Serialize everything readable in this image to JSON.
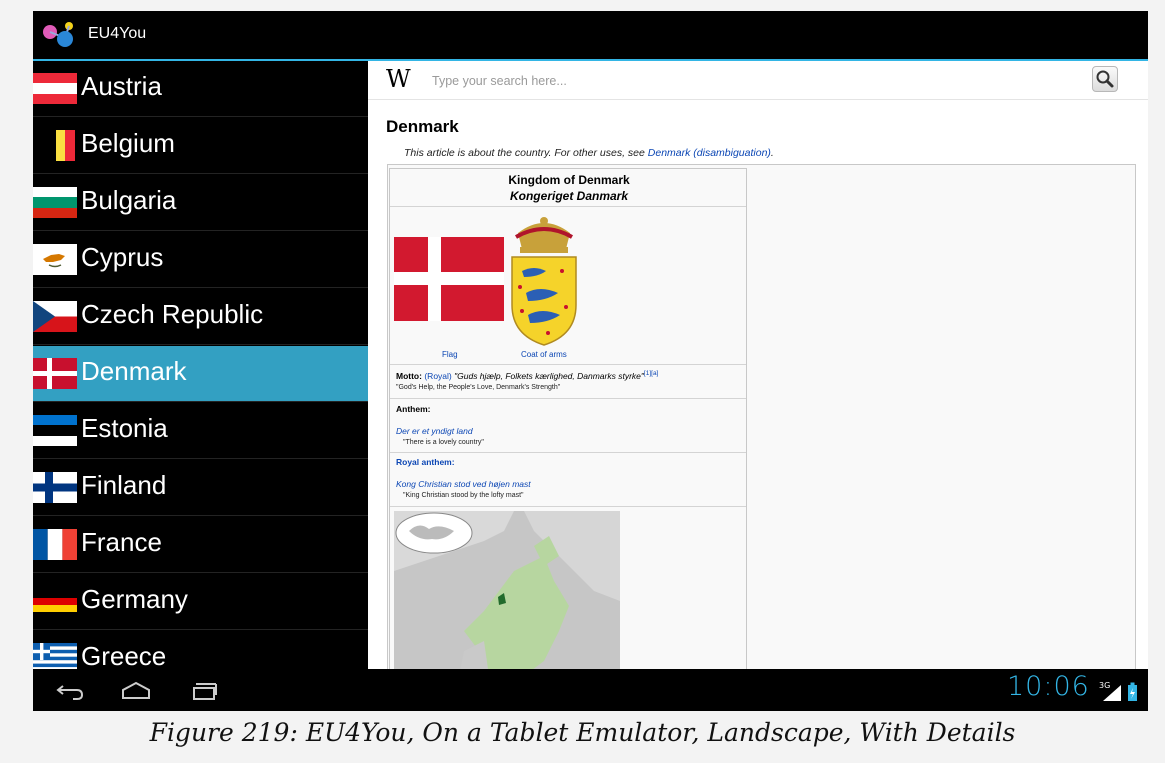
{
  "app": {
    "title": "EU4You"
  },
  "countries": [
    {
      "label": "Austria",
      "selected": false
    },
    {
      "label": "Belgium",
      "selected": false
    },
    {
      "label": "Bulgaria",
      "selected": false
    },
    {
      "label": "Cyprus",
      "selected": false
    },
    {
      "label": "Czech Republic",
      "selected": false
    },
    {
      "label": "Denmark",
      "selected": true
    },
    {
      "label": "Estonia",
      "selected": false
    },
    {
      "label": "Finland",
      "selected": false
    },
    {
      "label": "France",
      "selected": false
    },
    {
      "label": "Germany",
      "selected": false
    },
    {
      "label": "Greece",
      "selected": false
    }
  ],
  "web": {
    "search_placeholder": "Type your search here...",
    "wiki_logo": "W",
    "article_title": "Denmark",
    "hatnote_prefix": "This article is about the country. For other uses, see ",
    "hatnote_link": "Denmark (disambiguation)",
    "hatnote_suffix": ".",
    "infobox": {
      "title": "Kingdom of Denmark",
      "subtitle": "Kongeriget Danmark",
      "flag_caption": "Flag",
      "coat_caption": "Coat of arms",
      "motto_label": "Motto:",
      "motto_link": "(Royal)",
      "motto_text": " \"Guds hjælp, Folkets kærlighed, Danmarks styrke\"",
      "motto_refs": "[1][a]",
      "motto_translation": "\"God's Help, the People's Love, Denmark's Strength\"",
      "anthem_label": "Anthem:",
      "anthem_name": "Der er et yndigt land",
      "anthem_translation": "\"There is a lovely country\"",
      "royal_anthem_label": "Royal anthem:",
      "royal_anthem_name": "Kong Christian stod ved højen mast",
      "royal_anthem_translation": "\"King Christian stood by the lofty mast\""
    }
  },
  "statusbar": {
    "time": "10:06",
    "network": "3G"
  },
  "colors": {
    "accent": "#33b5e5",
    "selected_row": "#33a0c2",
    "link": "#0b46b4"
  },
  "figure_caption": "Figure 219: EU4You, On a Tablet Emulator, Landscape, With Details"
}
